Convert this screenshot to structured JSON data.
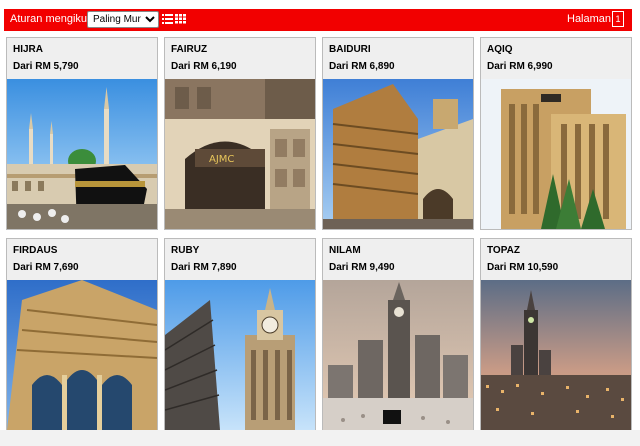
{
  "toolbar": {
    "sort_label": "Aturan mengikut:",
    "sort_selected": "Paling Murah",
    "list_icon": "list-view-icon",
    "grid_icon": "grid-view-icon",
    "page_label": "Halaman",
    "page_value": "1",
    "color": "#f20000"
  },
  "packages": [
    {
      "name": "HIJRA",
      "price": "Dari RM 5,790",
      "photo": "Masjid Nabawi & Kaabah"
    },
    {
      "name": "FAIRUZ",
      "price": "Dari RM 6,190",
      "photo": "AJMC hotel entrance"
    },
    {
      "name": "BAIDURI",
      "price": "Dari RM 6,890",
      "photo": "hotel tower"
    },
    {
      "name": "AQIQ",
      "price": "Dari RM 6,990",
      "photo": "AJMC hotel"
    },
    {
      "name": "FIRDAUS",
      "price": "Dari RM 7,690",
      "photo": "arched hotel"
    },
    {
      "name": "RUBY",
      "price": "Dari RM 7,890",
      "photo": "clock tower towers"
    },
    {
      "name": "NILAM",
      "price": "Dari RM 9,490",
      "photo": "Abraj Al Bait"
    },
    {
      "name": "TOPAZ",
      "price": "Dari RM 10,590",
      "photo": "Makkah skyline"
    }
  ]
}
